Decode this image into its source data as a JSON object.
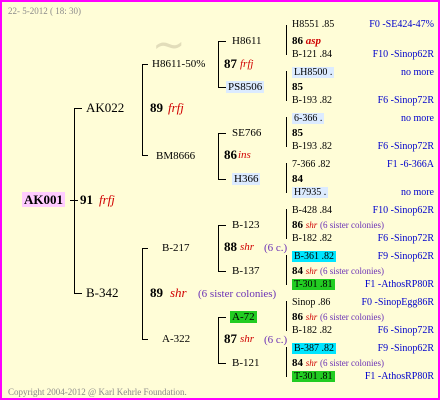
{
  "header": {
    "date": "22-  5-2012 ( 18: 30)"
  },
  "footer": {
    "copyright": "Copyright 2004-2012 @ Karl Kehrle Foundation."
  },
  "root": {
    "name": "AK001",
    "num": "91",
    "tag": "frfj"
  },
  "gen1": {
    "top": {
      "name": "AK022",
      "num": "89",
      "tag": "frfj"
    },
    "bottom": {
      "name": "B-342",
      "num": "89",
      "tag": "shr",
      "note": "(6 sister colonies)"
    }
  },
  "gen2": {
    "a": {
      "name": "H8611-50%",
      "num": "87",
      "tag": "frfj"
    },
    "b": {
      "name": "BM8666",
      "num": "86",
      "tag": "ins"
    },
    "c": {
      "name": "B-217",
      "num": "88",
      "tag": "shr",
      "note": "(6 c.)"
    },
    "d": {
      "name": "A-322",
      "num": "87",
      "tag": "shr",
      "note": "(6 c.)"
    }
  },
  "gen3": {
    "a1": {
      "name": "H8611",
      "num": "86",
      "tag": "asp"
    },
    "a2": {
      "name": "PS8506",
      "num": "85"
    },
    "b1": {
      "name": "SE766",
      "num": "85"
    },
    "b2": {
      "name": "H366",
      "num": "84"
    },
    "c1": {
      "name": "B-123",
      "num": "86",
      "tag": "shr",
      "note": "(6 sister colonies)"
    },
    "c2": {
      "name": "B-137",
      "num": "84",
      "tag": "shr",
      "note": "(6 sister colonies)"
    },
    "d1": {
      "name": "A-72",
      "num": "86",
      "tag": "shr",
      "note": "(6 sister colonies)"
    },
    "d2": {
      "name": "B-121",
      "num": "84",
      "tag": "shr",
      "note": "(6 sister colonies)"
    }
  },
  "gen4": [
    {
      "name": "H8551 .85",
      "right": "F0 -SE424-47%"
    },
    {
      "name": "B-121 .84",
      "right": "F10 -Sinop62R"
    },
    {
      "name": "LH8500 .",
      "right": "no more"
    },
    {
      "name": "B-193 .82",
      "right": "F6 -Sinop72R"
    },
    {
      "name": "6-366 .",
      "right": "no more"
    },
    {
      "name": "B-193 .82",
      "right": "F6 -Sinop72R"
    },
    {
      "name": "7-366 .82",
      "right": "F1 -6-366A"
    },
    {
      "name": "H7935 .",
      "right": "no more"
    },
    {
      "name": "B-428 .84",
      "right": "F10 -Sinop62R"
    },
    {
      "name": "B-182 .82",
      "right": "F6 -Sinop72R"
    },
    {
      "name": "B-361 .82",
      "right": "F9 -Sinop62R"
    },
    {
      "name": "T-301 .81",
      "right": "F1 -AthosRP80R"
    },
    {
      "name": "Sinop .86",
      "right": "F0 -SinopEgg86R"
    },
    {
      "name": "B-182 .82",
      "right": "F6 -Sinop72R"
    },
    {
      "name": "B-387 .82",
      "right": "F9 -Sinop62R"
    },
    {
      "name": "T-301 .81",
      "right": "F1 -AthosRP80R"
    }
  ],
  "colors": {
    "border": "#ff00ff",
    "background": "#fffdd7",
    "highlight_pink": "#ffccff",
    "highlight_cyan": "#00e5ff",
    "highlight_green": "#22cc22"
  }
}
